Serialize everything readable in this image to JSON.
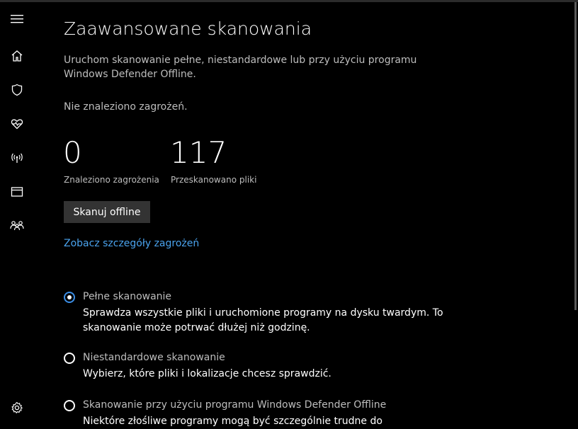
{
  "page": {
    "title": "Zaawansowane skanowania",
    "description": "Uruchom skanowanie pełne, niestandardowe lub przy użyciu programu Windows Defender Offline.",
    "status": "Nie znaleziono zagrożeń."
  },
  "stats": [
    {
      "value": "0",
      "label": "Znaleziono zagrożenia"
    },
    {
      "value": "117",
      "label": "Przeskanowano pliki"
    }
  ],
  "actions": {
    "scan_offline_label": "Skanuj offline",
    "threat_details_link": "Zobacz szczegóły zagrożeń"
  },
  "scan_options": [
    {
      "label": "Pełne skanowanie",
      "description": "Sprawdza wszystkie pliki i uruchomione programy na dysku twardym. To skanowanie może potrwać dłużej niż godzinę.",
      "selected": true
    },
    {
      "label": "Niestandardowe skanowanie",
      "description": "Wybierz, które pliki i lokalizacje chcesz sprawdzić.",
      "selected": false
    },
    {
      "label": "Skanowanie przy użyciu programu Windows Defender Offline",
      "description": "Niektóre złośliwe programy mogą być szczególnie trudne do",
      "selected": false
    }
  ],
  "sidebar": {
    "icons": [
      "hamburger-menu-icon",
      "home-icon",
      "shield-icon",
      "heart-pulse-icon",
      "wireless-antenna-icon",
      "app-browser-icon",
      "family-icon",
      "settings-gear-icon"
    ]
  },
  "colors": {
    "background": "#000000",
    "accent": "#3b8ee6",
    "link": "#4aa3ee",
    "button": "#333333",
    "muted_text": "#bdbdbd"
  }
}
